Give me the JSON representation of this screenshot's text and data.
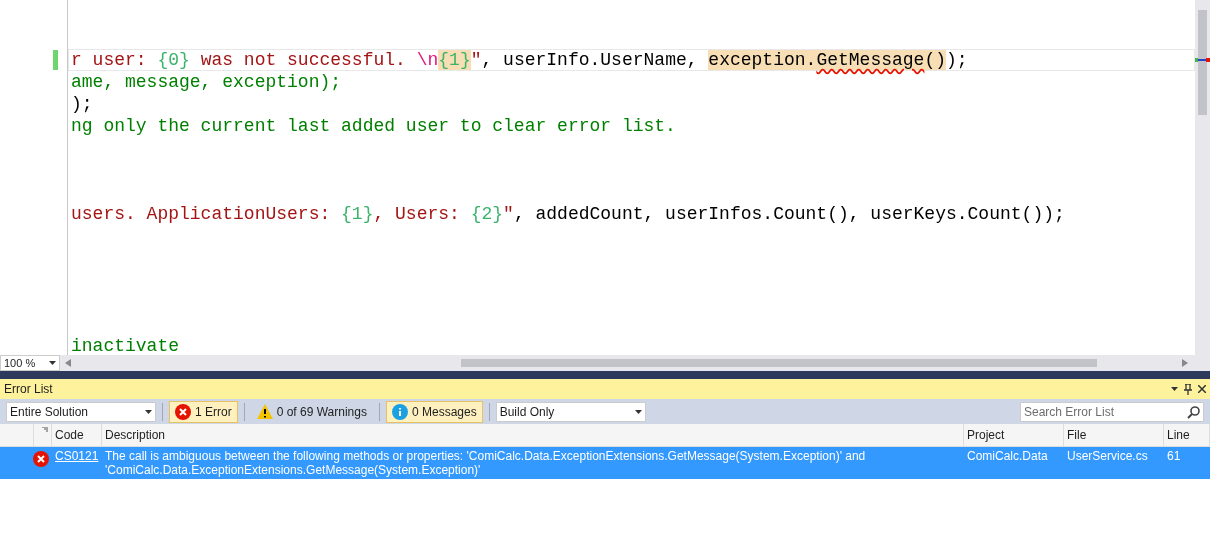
{
  "editor": {
    "lines": [
      {
        "kind": "blank"
      },
      {
        "kind": "blank"
      },
      {
        "kind": "code",
        "current": true,
        "changed": true,
        "tokens": [
          {
            "kind": "string",
            "text": "r user: "
          },
          {
            "kind": "format",
            "text": "{0}"
          },
          {
            "kind": "string",
            "text": " was not successful. "
          },
          {
            "kind": "escape",
            "text": "\\n"
          },
          {
            "kind": "format",
            "text": "{1}",
            "highlighted": true
          },
          {
            "kind": "string",
            "text": "\""
          },
          {
            "kind": "plain",
            "text": ", userInfo.UserName, "
          },
          {
            "kind": "plain",
            "text": "exception.",
            "highlighted": true
          },
          {
            "kind": "plain",
            "text": "GetMessage",
            "highlighted": true,
            "error": true
          },
          {
            "kind": "plain",
            "text": "()",
            "highlighted": true
          },
          {
            "kind": "plain",
            "text": ");"
          }
        ]
      },
      {
        "kind": "code",
        "tokens": [
          {
            "kind": "comment",
            "text": "ame, message, exception);"
          }
        ]
      },
      {
        "kind": "code",
        "tokens": [
          {
            "kind": "plain",
            "text": ");"
          }
        ]
      },
      {
        "kind": "code",
        "tokens": [
          {
            "kind": "comment",
            "text": "ng only the current last added user to clear error list."
          }
        ]
      },
      {
        "kind": "blank"
      },
      {
        "kind": "blank"
      },
      {
        "kind": "blank"
      },
      {
        "kind": "code",
        "tokens": [
          {
            "kind": "string",
            "text": "users. ApplicationUsers: "
          },
          {
            "kind": "format",
            "text": "{1}"
          },
          {
            "kind": "string",
            "text": ", Users: "
          },
          {
            "kind": "format",
            "text": "{2}"
          },
          {
            "kind": "string",
            "text": "\""
          },
          {
            "kind": "plain",
            "text": ", addedCount, userInfos.Count(), userKeys.Count());"
          }
        ]
      },
      {
        "kind": "blank"
      },
      {
        "kind": "blank"
      },
      {
        "kind": "blank"
      },
      {
        "kind": "blank"
      },
      {
        "kind": "blank"
      },
      {
        "kind": "code",
        "tokens": [
          {
            "kind": "comment",
            "text": "inactivate"
          }
        ]
      }
    ],
    "zoom": "100 %"
  },
  "error_list": {
    "title": "Error List",
    "scope": "Entire Solution",
    "filters": [
      {
        "kind": "error",
        "label": "1 Error",
        "selected": true
      },
      {
        "kind": "warning",
        "label": "0 of 69 Warnings",
        "selected": false
      },
      {
        "kind": "info",
        "label": "0 Messages",
        "selected": true
      }
    ],
    "build_filter": "Build Only",
    "search": {
      "placeholder": "Search Error List"
    },
    "columns": [
      "Code",
      "Description",
      "Project",
      "File",
      "Line"
    ],
    "rows": [
      {
        "kind": "error",
        "code": "CS0121",
        "description": "The call is ambiguous between the following methods or properties: 'ComiCalc.Data.ExceptionExtensions.GetMessage(System.Exception)' and 'ComiCalc.Data.ExceptionExtensions.GetMessage(System.Exception)'",
        "project": "ComiCalc.Data",
        "file": "UserService.cs",
        "line": "61",
        "selected": true
      }
    ]
  }
}
